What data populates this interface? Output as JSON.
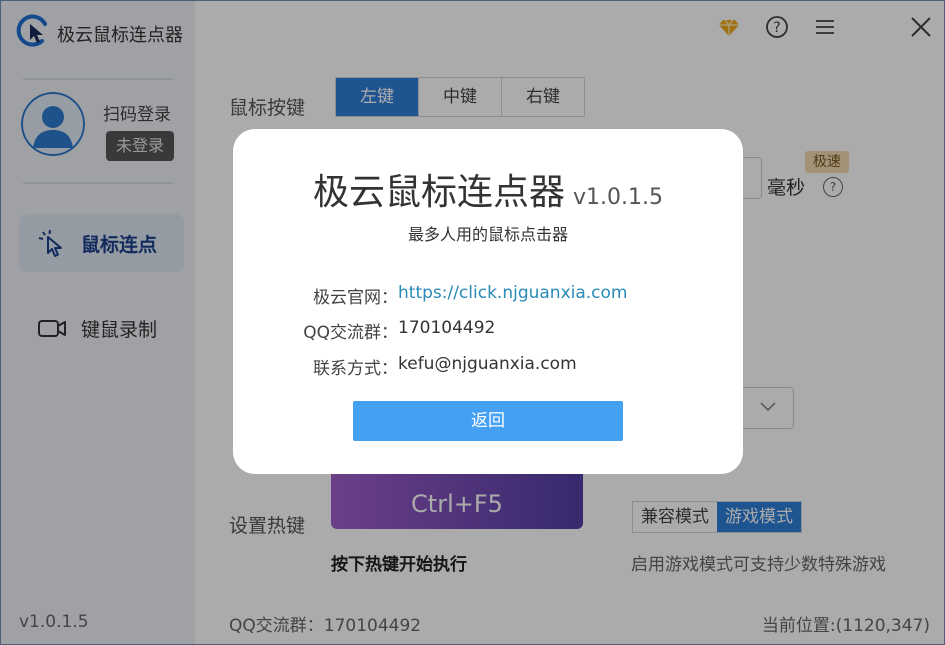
{
  "app": {
    "name": "极云鼠标连点器",
    "version": "v1.0.1.5"
  },
  "sidebar": {
    "login_text": "扫码登录",
    "login_badge": "未登录",
    "items": [
      {
        "label": "鼠标连点",
        "icon": "mouse-click-icon",
        "active": true
      },
      {
        "label": "键鼠录制",
        "icon": "video-camera-icon",
        "active": false
      }
    ]
  },
  "titlebar": {
    "icons": [
      "diamond-icon",
      "help-icon",
      "menu-icon",
      "close-icon"
    ]
  },
  "main": {
    "mouse_button_label": "鼠标按键",
    "mouse_buttons": [
      "左键",
      "中键",
      "右键"
    ],
    "interval_unit": "毫秒",
    "fast_badge": "极速",
    "hotkey_label": "设置热键",
    "hotkey_value": "Ctrl+F5",
    "hotkey_hint": "按下热键开始执行",
    "modes": [
      "兼容模式",
      "游戏模式"
    ],
    "mode_hint": "启用游戏模式可支持少数特殊游戏",
    "footer_qq": "QQ交流群：170104492",
    "footer_pos": "当前位置:(1120,347)"
  },
  "dialog": {
    "title": "极云鼠标连点器",
    "version": "v1.0.1.5",
    "subtitle": "最多人用的鼠标点击器",
    "rows": [
      {
        "key": "极云官网：",
        "value": "https://click.njguanxia.com"
      },
      {
        "key": "QQ交流群：",
        "value": "170104492"
      },
      {
        "key": "联系方式：",
        "value": "kefu@njguanxia.com"
      }
    ],
    "back_button": "返回"
  },
  "colors": {
    "accent": "#2e7fd9",
    "button": "#43a0f3",
    "link": "#2a8ab8",
    "badge": "#f2dcb4"
  }
}
